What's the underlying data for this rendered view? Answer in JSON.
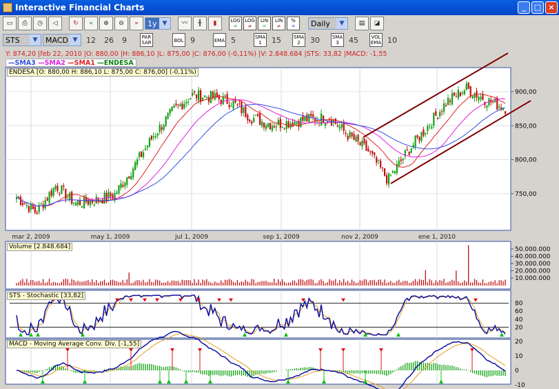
{
  "window": {
    "title": "Interactive Financial Charts"
  },
  "toolbar1": {
    "period": "1y",
    "interval": "Daily",
    "icons": [
      "new-window-icon",
      "print-icon",
      "timer-icon",
      "sound-icon",
      "refresh-icon",
      "back-icon",
      "zoom-in-icon",
      "zoom-out-icon",
      "forward-icon"
    ],
    "chart_types": [
      "line-chart-icon",
      "ohlc-chart-icon",
      "candle-chart-icon"
    ],
    "scales": [
      {
        "top": "LOG",
        "bot": "="
      },
      {
        "top": "LOG",
        "bot": "≠"
      },
      {
        "top": "LIN",
        "bot": "="
      },
      {
        "top": "LIN",
        "bot": "≠"
      },
      {
        "top": "%",
        "bot": "="
      }
    ]
  },
  "toolbar2": {
    "indicator1": "STS",
    "indicator2": "MACD",
    "macd_params": [
      "12",
      "26",
      "9"
    ],
    "overlays": [
      {
        "label": "PAR SAR",
        "value": ""
      },
      {
        "label": "BOL",
        "value": "9"
      },
      {
        "label": "EMA",
        "value": "5"
      },
      {
        "label": "SMA 1",
        "value": "15"
      },
      {
        "label": "SMA 2",
        "value": "30"
      },
      {
        "label": "SMA 3",
        "value": "45"
      },
      {
        "label": "VOL EMA",
        "value": "10"
      }
    ]
  },
  "info_line": "Y: 874,20 |feb 22, 2010 |O: 880,00 |H: 886,10 |L: 875,00 |C: 876,00 (-0,11%) |V: 2.848.684 |STS: 33,82 |MACD: -1,55",
  "legend": [
    {
      "label": "SMA3",
      "color": "#3050e0"
    },
    {
      "label": "SMA2",
      "color": "#e020e0"
    },
    {
      "label": "SMA1",
      "color": "#e02020"
    },
    {
      "label": "ENDESA",
      "color": "#108010"
    }
  ],
  "ohlc_label": "ENDESA [O: 880,00  H: 886,10  L: 875,00  C: 876,00] (-0,11%)",
  "panels": {
    "volume": "Volume [2.848.684]",
    "stochastic": "STS - Stochastic [33,82]",
    "macd": "MACD - Moving Average Conv. Div. [-1,55]"
  },
  "chart_data": {
    "type": "candlestick",
    "x_ticks": [
      "mar 2, 2009",
      "may 1, 2009",
      "jul 1, 2009",
      "sep 1, 2009",
      "nov 2, 2009",
      "ene 1, 2010"
    ],
    "price_ticks": [
      "900,00",
      "850,00",
      "800,00",
      "750,00"
    ],
    "price_range": [
      700,
      935
    ],
    "price_anchors": [
      745,
      722,
      762,
      736,
      740,
      748,
      790,
      835,
      872,
      895,
      892,
      885,
      862,
      852,
      855,
      860,
      862,
      835,
      812,
      770,
      812,
      848,
      885,
      905,
      888,
      876
    ],
    "volume_ticks": [
      "50.000.000",
      "40.000.000",
      "30.000.000",
      "20.000.000",
      "10.000.000"
    ],
    "stoch_ticks": [
      "80",
      "60",
      "40",
      "20"
    ],
    "macd_ticks": [
      "20",
      "10",
      "0",
      "-10"
    ],
    "colors": {
      "up": "#10a010",
      "down": "#c01010",
      "sma1": "#e02020",
      "sma2": "#e020e0",
      "sma3": "#3050e0",
      "channel": "#800000"
    }
  }
}
